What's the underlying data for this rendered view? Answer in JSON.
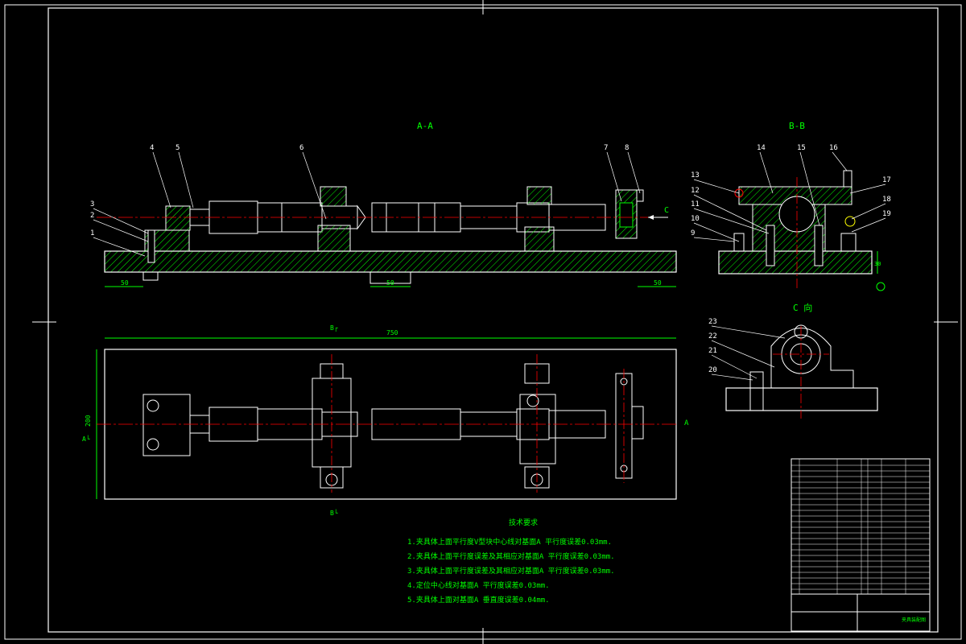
{
  "views": {
    "section_aa": "A-A",
    "section_bb": "B-B",
    "view_c": "C 向",
    "section_b_top": "B┌",
    "section_b_bottom": "B└",
    "arrow_c": "C",
    "arrow_a_right": "A",
    "arrow_a_left": "A└"
  },
  "balloons": [
    "1",
    "2",
    "3",
    "4",
    "5",
    "6",
    "7",
    "8",
    "9",
    "10",
    "11",
    "12",
    "13",
    "14",
    "15",
    "16",
    "17",
    "18",
    "19",
    "20",
    "21",
    "22",
    "23"
  ],
  "dimensions": {
    "left_50": "50",
    "mid_50": "50",
    "right_50": "50",
    "overall_length": "750",
    "overall_width": "200",
    "height_30": "30"
  },
  "requirements": {
    "title": "技术要求",
    "items": [
      "1.夹具体上面平行度V型块中心线对基面A 平行度误差0.03mm.",
      "2.夹具体上面平行度误差及其相应对基面A 平行度误差0.03mm.",
      "3.夹具体上面平行度误差及其相应对基面A 平行度误差0.03mm.",
      "4.定位中心线对基面A 平行度误差0.03mm.",
      "5.夹具体上面对基面A 垂直度误差0.04mm."
    ]
  },
  "title_block": {
    "drawing_name": "夹具装配图"
  },
  "colors": {
    "outline": "#ffffff",
    "green": "#00ff00",
    "centerline": "#ff0000",
    "hatch": "#00ff00",
    "yellow": "#ffff00",
    "magenta": "#ff00ff"
  }
}
